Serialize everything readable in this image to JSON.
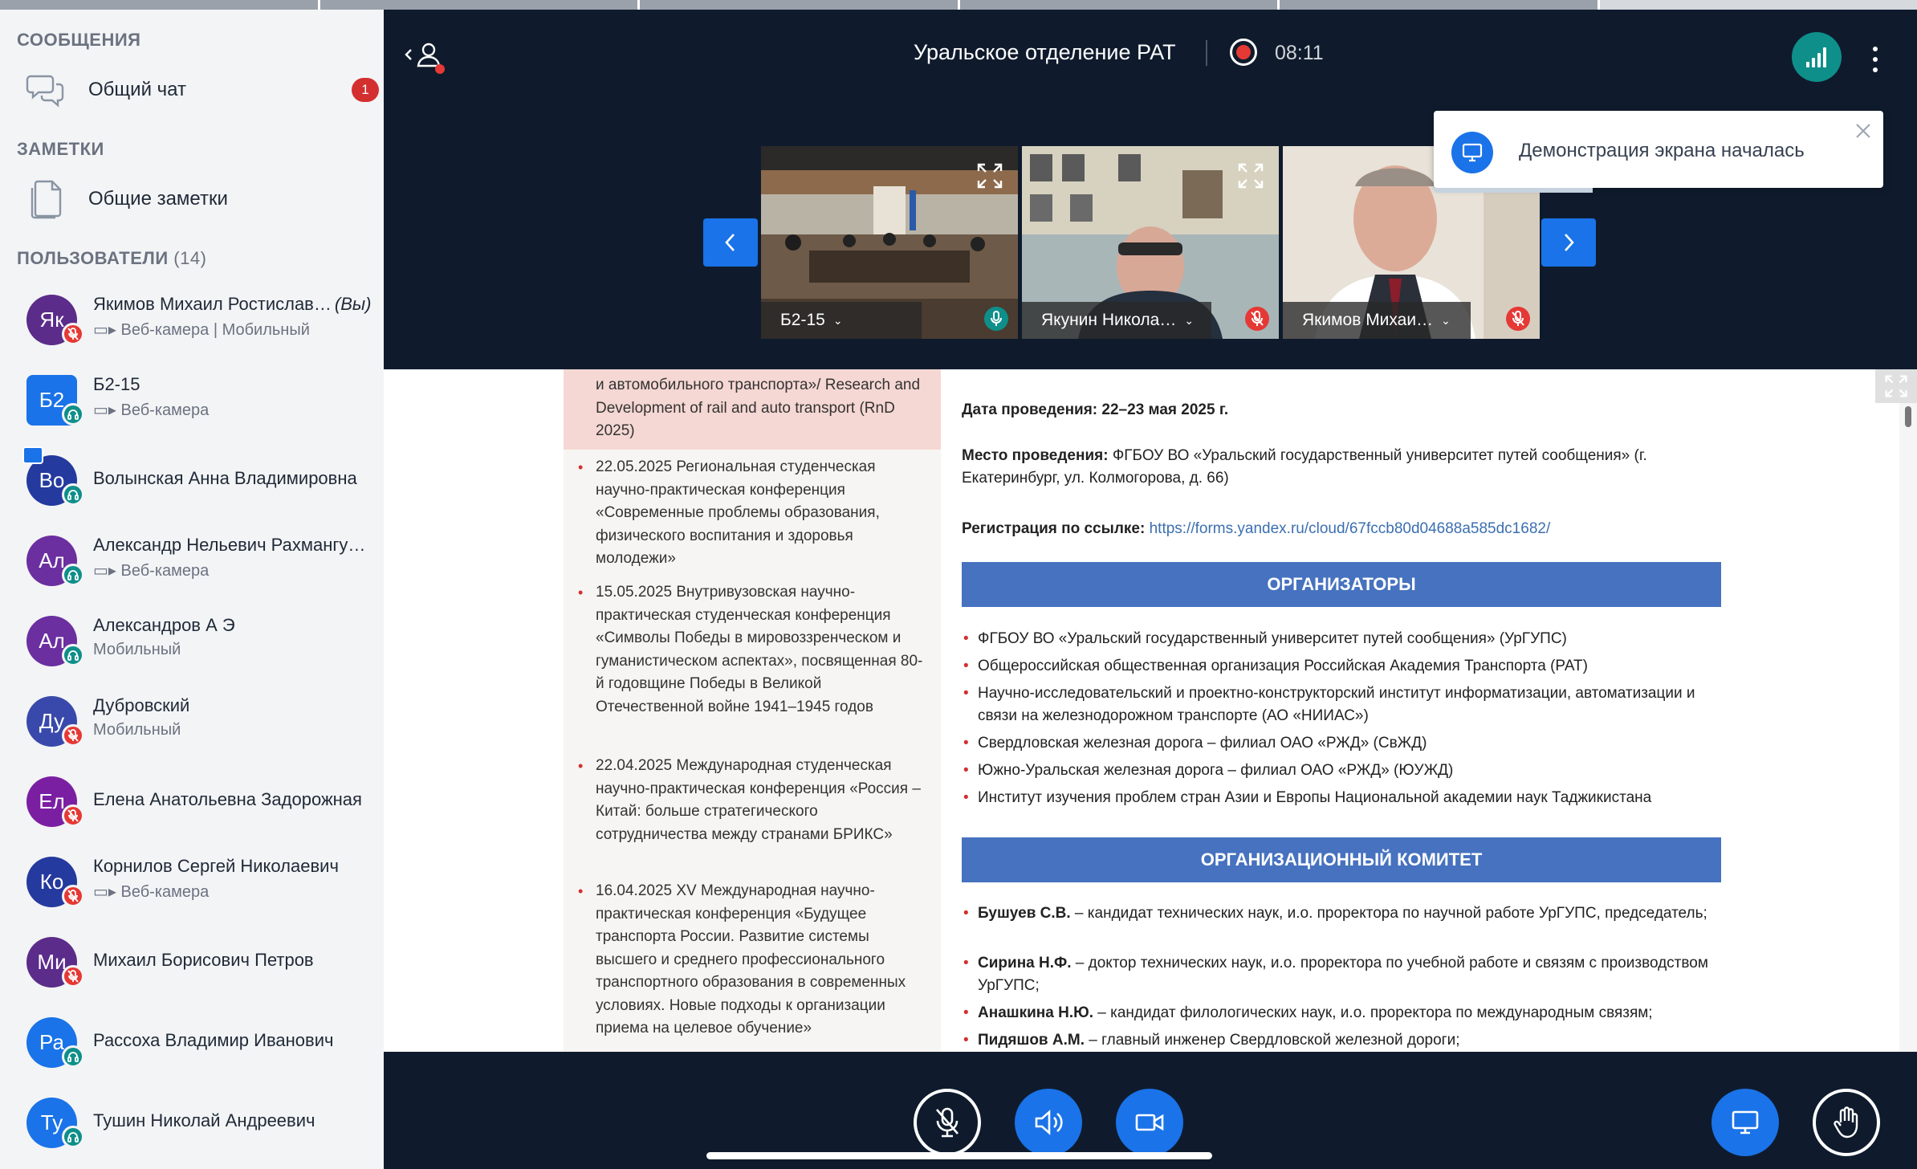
{
  "sidebar": {
    "messages_heading": "СООБЩЕНИЯ",
    "general_chat_label": "Общий чат",
    "general_chat_badge": "1",
    "notes_heading": "ЗАМЕТКИ",
    "shared_notes_label": "Общие заметки",
    "users_heading": "ПОЛЬЗОВАТЕЛИ",
    "users_count": "(14)",
    "users": [
      {
        "initials": "Як",
        "name": "Якимов Михаил Ростислав…",
        "you": "(Вы)",
        "sub": "▭▸ Веб-камера | Мобильный",
        "avatar_color": "#5b2c8a",
        "status": "red"
      },
      {
        "initials": "Б2",
        "name": "Б2-15",
        "sub": "▭▸ Веб-камера",
        "avatar_color": "#1a73e8",
        "status": "teal"
      },
      {
        "initials": "Во",
        "name": "Волынская Анна Владимировна",
        "sub": "",
        "avatar_color": "#253a9e",
        "status": "teal"
      },
      {
        "initials": "Ал",
        "name": "Александр Нельевич Рахмангу…",
        "sub": "▭▸ Веб-камера",
        "avatar_color": "#6b2fa0",
        "status": "teal"
      },
      {
        "initials": "Ал",
        "name": "Александров А Э",
        "sub": "Мобильный",
        "avatar_color": "#6b2fa0",
        "status": "teal"
      },
      {
        "initials": "Ду",
        "name": "Дубровский",
        "sub": "Мобильный",
        "avatar_color": "#3949ab",
        "status": "red"
      },
      {
        "initials": "Ел",
        "name": "Елена Анатольевна Задорожная",
        "sub": "",
        "avatar_color": "#7b1fa2",
        "status": "red"
      },
      {
        "initials": "Ко",
        "name": "Корнилов Сергей Николаевич",
        "sub": "▭▸ Веб-камера",
        "avatar_color": "#253a9e",
        "status": "red"
      },
      {
        "initials": "Ми",
        "name": "Михаил Борисович Петров",
        "sub": "",
        "avatar_color": "#5b2c8a",
        "status": "red"
      },
      {
        "initials": "Ра",
        "name": "Рассоха Владимир Иванович",
        "sub": "",
        "avatar_color": "#1a73e8",
        "status": "teal"
      },
      {
        "initials": "Ту",
        "name": "Тушин Николай Андреевич",
        "sub": "",
        "avatar_color": "#1a73e8",
        "status": "teal"
      }
    ]
  },
  "header": {
    "title": "Уральское отделение РАТ",
    "timer": "08:11"
  },
  "videos": [
    {
      "name": "Б2-15",
      "mic": "on"
    },
    {
      "name": "Якунин Никола…",
      "mic": "off"
    },
    {
      "name": "Якимов Михаи…",
      "mic": "off"
    }
  ],
  "toast": {
    "text": "Демонстрация экрана началась"
  },
  "document": {
    "left_top_text": "и автомобильного транспорта»/ Research and Development of rail and auto transport (RnD 2025)",
    "left_items": [
      "22.05.2025 Региональная студенческая научно-практическая конференция «Современные проблемы образования, физического воспитания и здоровья молодежи»",
      "15.05.2025 Внутривузовская научно-практическая студенческая конференция «Символы Победы в мировоззренческом и гуманистическом аспектах», посвященная 80-й годовщине Победы в Великой Отечественной войне 1941–1945 годов",
      "22.04.2025 Международная студенческая научно-практическая конференция «Россия – Китай: больше стратегического сотрудничества между странами БРИКС»",
      "16.04.2025 XV Международная научно-практическая конференция «Будущее транспорта России. Развитие системы высшего и среднего профессионального транспортного образования в современных условиях. Новые подходы к организации приема на целевое обучение»"
    ],
    "date_label": "Дата проведения:",
    "date_value": "22–23 мая 2025 г.",
    "place_label": "Место проведения:",
    "place_value": "ФГБОУ ВО «Уральский государственный университет путей сообщения» (г. Екатеринбург, ул. Колмогорова, д. 66)",
    "reg_label": "Регистрация по ссылке:",
    "reg_link": "https://forms.yandex.ru/cloud/67fccb80d04688a585dc1682/",
    "organizers_heading": "ОРГАНИЗАТОРЫ",
    "organizers": [
      "ФГБОУ ВО «Уральский государственный университет путей сообщения» (УрГУПС)",
      "Общероссийская общественная организация Российская Академия Транспорта (РАТ)",
      "Научно-исследовательский и проектно-конструкторский институт информатизации, автоматизации и связи на железнодорожном транспорте (АО «НИИАС»)",
      "Свердловская железная дорога – филиал ОАО «РЖД» (СвЖД)",
      "Южно-Уральская железная дорога – филиал ОАО «РЖД» (ЮУЖД)",
      "Институт изучения проблем стран Азии и Европы Национальной академии наук Таджикистана"
    ],
    "committee_heading": "ОРГАНИЗАЦИОННЫЙ КОМИТЕТ",
    "committee": [
      {
        "name": "Бушуев С.В.",
        "desc": " – кандидат технических наук, и.о. проректора по научной работе УрГУПС, председатель;"
      },
      {
        "name": "Сирина Н.Ф.",
        "desc": " – доктор технических наук, и.о. проректора по учебной работе и связям с производством УрГУПС;"
      },
      {
        "name": "Анашкина Н.Ю.",
        "desc": " – кандидат филологических наук, и.о. проректора по международным связям;"
      },
      {
        "name": "Пидяшов А.М.",
        "desc": " – главный инженер Свердловской железной дороги;"
      }
    ]
  },
  "colors": {
    "accent": "#1a73e8",
    "teal": "#0e8f8a",
    "danger": "#e53935",
    "band": "#4672bf"
  }
}
